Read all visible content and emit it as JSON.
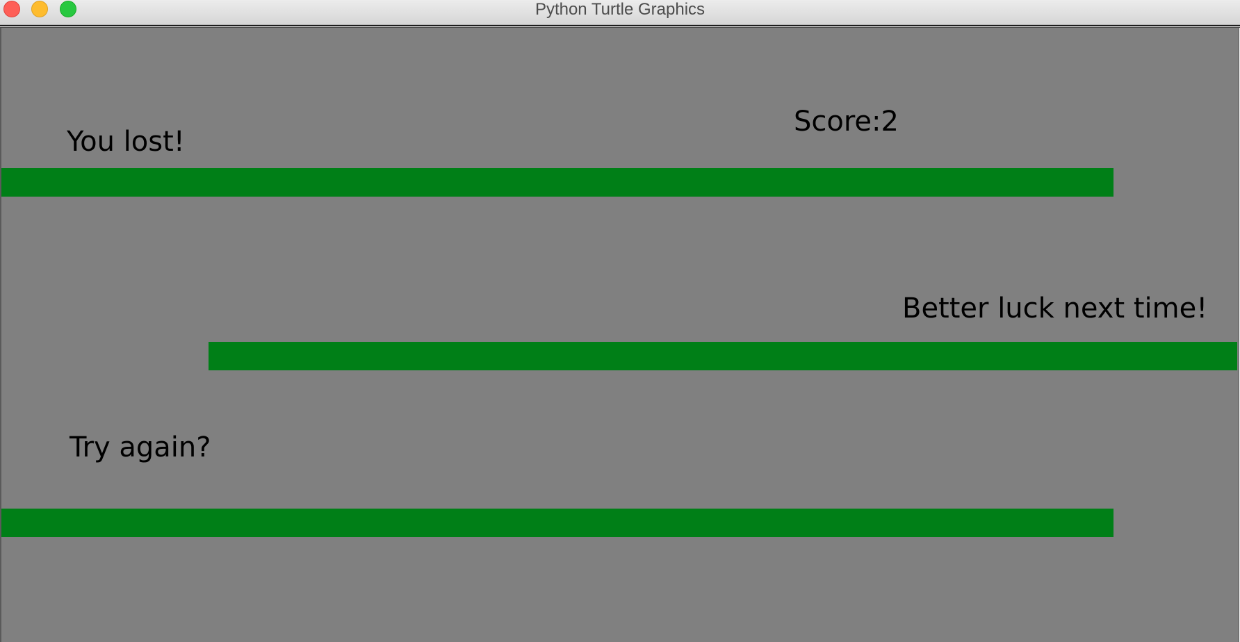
{
  "window": {
    "title": "Python Turtle Graphics"
  },
  "game": {
    "score_text": "Score:2",
    "messages": {
      "lost": "You lost!",
      "better_luck": "Better luck next time!",
      "try_again": "Try again?"
    }
  },
  "colors": {
    "canvas_background": "#808080",
    "bar": "#007f17",
    "text": "#000000"
  }
}
